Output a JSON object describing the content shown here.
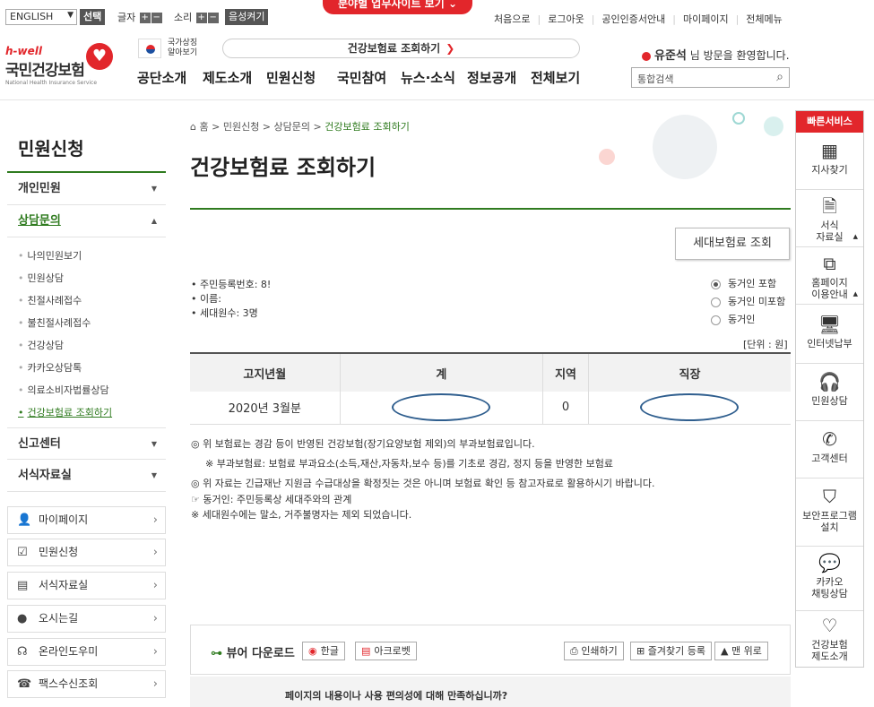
{
  "topbar": {
    "language": "ENGLISH",
    "select_label": "선택",
    "text_size_label": "글자",
    "sound_label": "소리",
    "plus": "+",
    "minus": "−",
    "voice_label": "음성켜기",
    "banner_label": "분야별 업무사이트 보기",
    "links": [
      "처음으로",
      "로그아웃",
      "공인인증서안내",
      "마이페이지",
      "전체메뉴"
    ]
  },
  "header": {
    "logo_hwell": "h-well",
    "logo_kr": "국민건강보험",
    "logo_en": "National Health Insurance Service",
    "flag_text_1": "국가상징",
    "flag_text_2": "알아보기",
    "quick_search_label": "건강보험료 조회하기",
    "gnb": [
      "공단소개",
      "제도소개",
      "민원신청",
      "국민참여",
      "뉴스·소식",
      "정보공개",
      "전체보기"
    ],
    "user_name": "유준석",
    "welcome_suffix": "님 방문을 환영합니다.",
    "search_placeholder": "통합검색"
  },
  "sidebar": {
    "title": "민원신청",
    "categories": [
      {
        "label": "개인민원"
      },
      {
        "label": "상담문의"
      },
      {
        "label": "신고센터"
      },
      {
        "label": "서식자료실"
      }
    ],
    "sub_items": [
      "나의민원보기",
      "민원상담",
      "친절사례접수",
      "불친절사례접수",
      "건강상담",
      "카카오상담톡",
      "의료소비자법률상담",
      "건강보험료 조회하기"
    ],
    "quick_links": [
      {
        "label": "마이페이지",
        "icon": "person-icon"
      },
      {
        "label": "민원신청",
        "icon": "checkbox-icon"
      },
      {
        "label": "서식자료실",
        "icon": "book-icon"
      },
      {
        "label": "오시는길",
        "icon": "location-icon"
      },
      {
        "label": "온라인도우미",
        "icon": "headset-icon"
      },
      {
        "label": "팩스수신조회",
        "icon": "fax-icon"
      }
    ]
  },
  "content": {
    "breadcrumb": [
      "홈",
      "민원신청",
      "상담문의",
      "건강보험료 조회하기"
    ],
    "title": "건강보험료 조회하기",
    "household_button": "세대보험료 조회",
    "info": [
      "주민등록번호: 8!",
      "이름:",
      "세대원수: 3명"
    ],
    "radio_options": [
      "동거인 포함",
      "동거인 미포함",
      "동거인"
    ],
    "unit": "[단위 : 원]",
    "table": {
      "headers": [
        "고지년월",
        "계",
        "지역",
        "직장"
      ],
      "row": [
        "2020년 3월분",
        "",
        "0",
        ""
      ]
    },
    "notes": [
      "◎ 위 보험료는 경감 등이 반영된 건강보험(장기요양보험 제외)의 부과보험료입니다.",
      "※ 부과보험료: 보험료 부과요소(소득,재산,자동차,보수 등)를 기초로 경감, 정지 등을 반영한 보험료",
      "◎ 위 자료는 긴급재난 지원금 수급대상을 확정짓는 것은 아니며 보험료 확인 등 참고자료로 활용하시기 바랍니다.",
      "☞ 동거인: 주민등록상 세대주와의 관계",
      "※ 세대원수에는 말소, 거주불명자는 제외 되었습니다."
    ],
    "viewer": {
      "title": "뷰어 다운로드",
      "buttons": [
        "한글",
        "아크로벳"
      ],
      "tools": [
        "인쇄하기",
        "즐겨찾기 등록",
        "맨 위로"
      ]
    },
    "satisfaction": "페이지의 내용이나 사용 편의성에 대해 만족하십니까?"
  },
  "quick_service": {
    "title": "빠른서비스",
    "items": [
      "지사찾기",
      "서식\n자료실",
      "홈페이지\n이용안내",
      "인터넷납부",
      "민원상담",
      "고객센터",
      "보안프로그램\n설치",
      "카카오\n채팅상담",
      "건강보험\n제도소개"
    ]
  },
  "colors": {
    "accent": "#e2262b",
    "green": "#2f7b1f",
    "mask": "#2f5e8e"
  }
}
